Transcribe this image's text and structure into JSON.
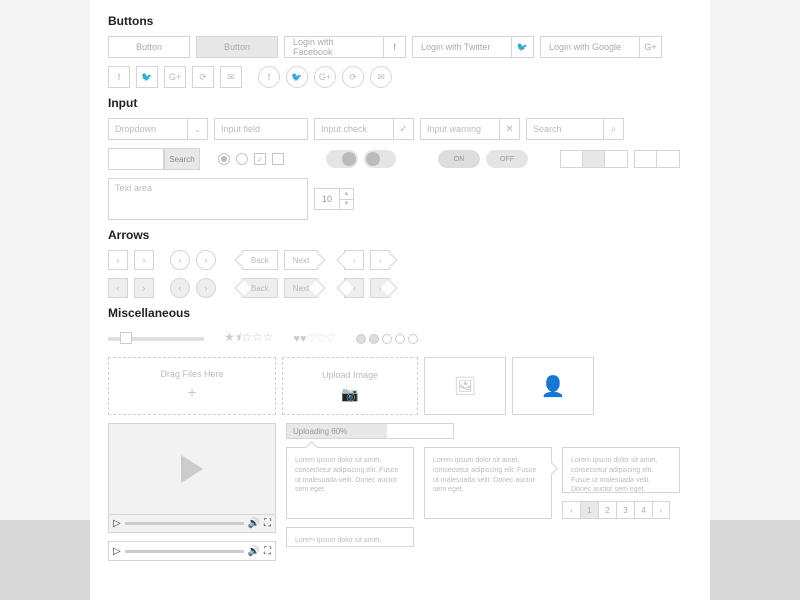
{
  "sections": {
    "buttons": "Buttons",
    "input": "Input",
    "arrows": "Arrows",
    "misc": "Miscellaneous"
  },
  "buttons": {
    "primary": "Button",
    "secondary": "Button",
    "fb": "Login with Facebook",
    "tw": "Login with Twitter",
    "gg": "Login with Google"
  },
  "input": {
    "dropdown": "Dropdown",
    "field": "Input field",
    "check": "Input check",
    "warning": "Input warning",
    "search": "Search",
    "searchBtn": "Search",
    "textarea": "Text area",
    "stepperVal": "10",
    "toggleOn": "ON",
    "toggleOff": "OFF"
  },
  "arrows": {
    "back": "Back",
    "next": "Next"
  },
  "misc": {
    "drag": "Drag Files Here",
    "upload": "Upload Image",
    "uploading": "Uploading 60%",
    "lorem": "Lorem ipsum dolor sit amet, consectetur adipiscing elit. Fusce ut malesuada velit. Donec auctor sem eget.",
    "pages": [
      "1",
      "2",
      "3",
      "4"
    ]
  }
}
